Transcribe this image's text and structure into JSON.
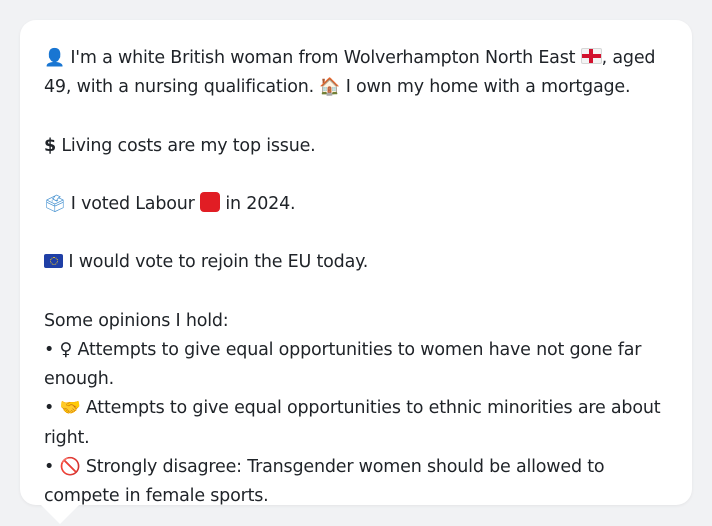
{
  "intro": {
    "line1": "I'm a white British woman from Wolverhampton North East",
    "line1b": ", aged 49, with a nursing qualification.",
    "home": "I own my home with a mortgage."
  },
  "issue": "Living costs are my top issue.",
  "vote": {
    "before": "I voted Labour",
    "after": "in 2024."
  },
  "eu": "I would vote to rejoin the EU today.",
  "opinions": {
    "heading": "Some opinions I hold:",
    "items": [
      {
        "bullet": "•",
        "icon": "♀",
        "text": " Attempts to give equal opportunities to women have not gone far enough."
      },
      {
        "bullet": "•",
        "icon": "🤝",
        "text": "Attempts to give equal opportunities to ethnic minorities are about right."
      },
      {
        "bullet": "•",
        "icon": "🚫",
        "text": "Strongly disagree: Transgender women should be allowed to compete in female sports."
      }
    ]
  },
  "icons": {
    "person": "👤",
    "england_flag": "england-flag-icon",
    "house": "🏠",
    "dollar": "$",
    "ballot": "🗳",
    "red_square": "red-square-icon",
    "eu_flag": "eu-flag-icon"
  },
  "colors": {
    "background": "#f1f2f4",
    "bubble": "#ffffff",
    "text": "#1f2328",
    "labour_red": "#e11d24"
  }
}
